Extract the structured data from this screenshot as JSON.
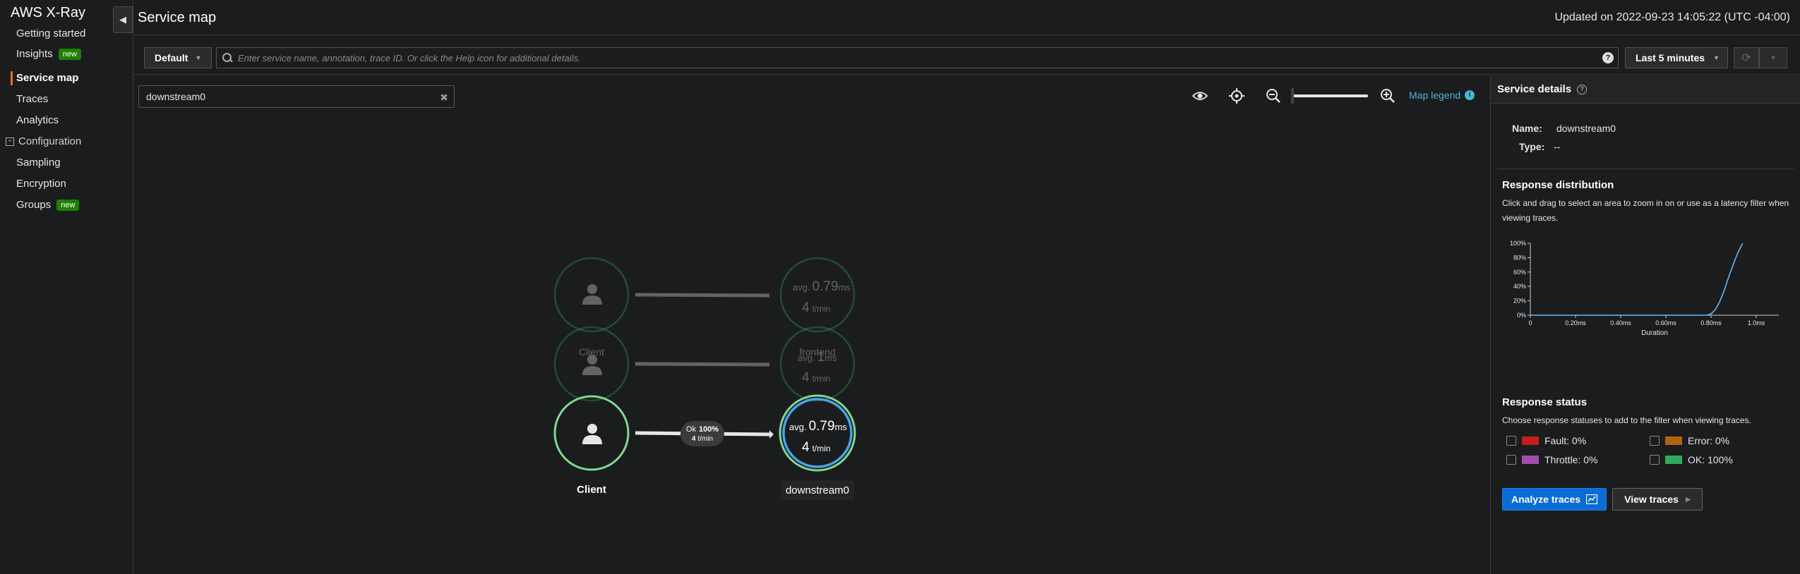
{
  "sidebar": {
    "title": "AWS X-Ray",
    "items": [
      {
        "label": "Getting started"
      },
      {
        "label": "Insights",
        "badge": "new"
      },
      {
        "label": "Service map"
      },
      {
        "label": "Traces"
      },
      {
        "label": "Analytics"
      }
    ],
    "section_label": "Configuration",
    "config_items": [
      {
        "label": "Sampling"
      },
      {
        "label": "Encryption"
      },
      {
        "label": "Groups",
        "badge": "new"
      }
    ]
  },
  "header": {
    "title": "Service map",
    "updated": "Updated on 2022-09-23 14:05:22 (UTC -04:00)"
  },
  "filter": {
    "group": "Default",
    "search_placeholder": "Enter service name, annotation, trace ID. Or click the Help icon for additional details.",
    "time_range": "Last 5 minutes"
  },
  "map": {
    "node_filter_value": "downstream0",
    "legend_label": "Map legend",
    "edge_label": {
      "status": "Ok",
      "percent": "100%",
      "rate": "4",
      "rate_unit": "t/min"
    },
    "ghost_rows": [
      {
        "client_label": "",
        "service_label": "",
        "avg": "0.79",
        "avg_prefix": "avg.",
        "avg_unit": "ms",
        "rate": "4",
        "rate_unit": "t/min"
      },
      {
        "client_label": "Client",
        "service_label": "frontend",
        "avg": "1",
        "avg_prefix": "avg.",
        "avg_unit": "ms",
        "rate": "4",
        "rate_unit": "t/min"
      }
    ],
    "active_row": {
      "client_label": "Client",
      "service_label": "downstream0",
      "avg": "0.79",
      "avg_prefix": "avg.",
      "avg_unit": "ms",
      "rate": "4",
      "rate_unit": "t/min"
    }
  },
  "panel": {
    "title": "Service details",
    "name_label": "Name:",
    "name_value": "downstream0",
    "type_label": "Type:",
    "type_value": "--",
    "response_distribution": {
      "title": "Response distribution",
      "description": "Click and drag to select an area to zoom in on or use as a latency filter when viewing traces."
    },
    "response_status": {
      "title": "Response status",
      "description": "Choose response statuses to add to the filter when viewing traces.",
      "items": [
        {
          "label": "Fault: 0%",
          "color": "#c61d1d"
        },
        {
          "label": "Error: 0%",
          "color": "#b0650a"
        },
        {
          "label": "Throttle: 0%",
          "color": "#a44dae"
        },
        {
          "label": "OK: 100%",
          "color": "#2eaa5c"
        }
      ]
    },
    "analyze_label": "Analyze traces",
    "view_label": "View traces"
  },
  "chart_data": {
    "type": "line",
    "title": "",
    "xlabel": "Duration",
    "ylabel": "",
    "x_ticks": [
      "0",
      "0.20ms",
      "0.40ms",
      "0.60ms",
      "0.80ms",
      "1.0ms"
    ],
    "y_ticks": [
      "0%",
      "20%",
      "40%",
      "60%",
      "80%",
      "100%"
    ],
    "xlim": [
      0,
      1.1
    ],
    "ylim": [
      0,
      100
    ],
    "series": [
      {
        "x": [
          0,
          0.2,
          0.4,
          0.6,
          0.78,
          0.8,
          0.82,
          0.84,
          0.86,
          0.88,
          0.9,
          0.92,
          0.94
        ],
        "y": [
          0,
          0,
          0,
          0,
          0,
          2,
          8,
          20,
          36,
          55,
          72,
          88,
          100
        ]
      }
    ],
    "grid": false
  }
}
